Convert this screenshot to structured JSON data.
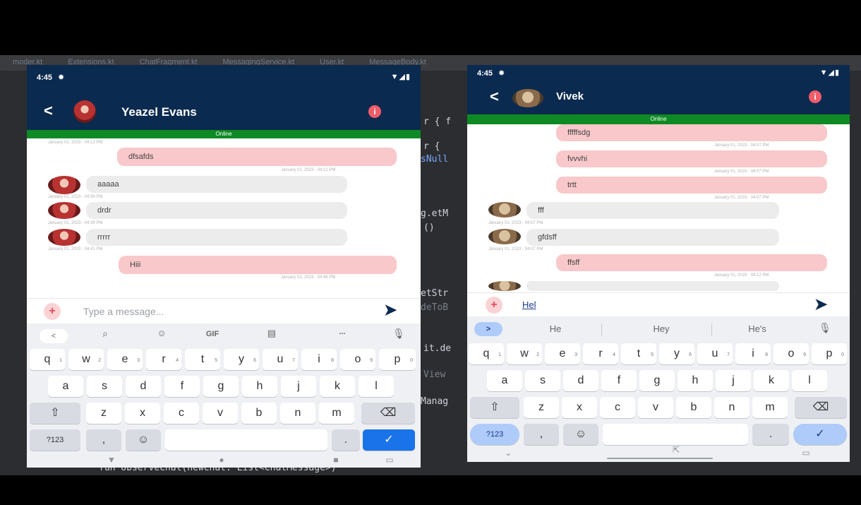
{
  "ide": {
    "tabs": [
      "moder.kt",
      "Extensions.kt",
      "ChatFragment.kt",
      "MessagingService.kt",
      "User.kt",
      "MessageBody.kt"
    ],
    "code_fragments": [
      "r { f",
      "r {",
      "sNull",
      "g.etM",
      "()",
      "etStr",
      "deToB",
      "it.de",
      "View",
      "Manag",
      "fun observeChat(newChat: List<ChatMessage>)"
    ]
  },
  "phone1": {
    "time": "4:45",
    "contact_name": "Yeazel Evans",
    "online_label": "Online",
    "messages": [
      {
        "side": "top-ts",
        "time": "January 01, 2023 - 04:12 PM"
      },
      {
        "side": "right",
        "text": "dfsafds",
        "time": "January 01, 2023 - 04:12 PM"
      },
      {
        "side": "left",
        "text": "aaaaa",
        "time": "January 01, 2023 - 04:39 PM"
      },
      {
        "side": "left",
        "text": "drdr",
        "time": "January 01, 2023 - 04:39 PM"
      },
      {
        "side": "left",
        "text": "rrrrr",
        "time": "January 01, 2023 - 04:41 PM"
      },
      {
        "side": "right",
        "text": "Hiii",
        "time": "January 01, 2023 - 04:45 PM"
      }
    ],
    "input_placeholder": "Type a message...",
    "toolbar": [
      "<",
      "search-icon",
      "sticker-icon",
      "GIF",
      "clipboard-icon",
      "...",
      "mic-icon"
    ],
    "rows": [
      [
        "q",
        "w",
        "e",
        "r",
        "t",
        "y",
        "u",
        "i",
        "o",
        "p"
      ],
      [
        "a",
        "s",
        "d",
        "f",
        "g",
        "h",
        "j",
        "k",
        "l"
      ],
      [
        "z",
        "x",
        "c",
        "v",
        "b",
        "n",
        "m"
      ]
    ],
    "superscripts": [
      "1",
      "2",
      "3",
      "4",
      "5",
      "6",
      "7",
      "8",
      "9",
      "0"
    ],
    "symbols_key": "?123",
    "comma_key": ",",
    "period_key": "."
  },
  "phone2": {
    "time": "4:45",
    "contact_name": "Vivek",
    "online_label": "Online",
    "messages": [
      {
        "side": "right",
        "text": "fffffsdg",
        "time": "January 01, 2023 - 04:07 PM"
      },
      {
        "side": "right",
        "text": "fvvvhi",
        "time": "January 01, 2023 - 04:07 PM"
      },
      {
        "side": "right",
        "text": "trtt",
        "time": "January 01, 2023 - 04:07 PM"
      },
      {
        "side": "left",
        "text": "fff",
        "time": "January 01, 2023 - 04:07 PM"
      },
      {
        "side": "left",
        "text": "gfdsff",
        "time": "January 01, 2023 - 04:07 PM"
      },
      {
        "side": "right",
        "text": "ffsff",
        "time": "January 01, 2023 - 04:12 PM"
      }
    ],
    "input_value": "Hel",
    "suggestions": [
      "He",
      "Hey",
      "He's"
    ],
    "rows": [
      [
        "q",
        "w",
        "e",
        "r",
        "t",
        "y",
        "u",
        "i",
        "o",
        "p"
      ],
      [
        "a",
        "s",
        "d",
        "f",
        "g",
        "h",
        "j",
        "k",
        "l"
      ],
      [
        "z",
        "x",
        "c",
        "v",
        "b",
        "n",
        "m"
      ]
    ],
    "superscripts": [
      "1",
      "2",
      "3",
      "4",
      "5",
      "6",
      "7",
      "8",
      "9",
      "0"
    ],
    "symbols_key": "?123",
    "comma_key": ",",
    "period_key": "."
  },
  "colors": {
    "appbar": "#0b2a4f",
    "online_bar": "#0d8a23",
    "sent_bubble": "#f8c8ca",
    "received_bubble": "#ececec",
    "accent_pink": "#f35d6a",
    "enter_key_blue": "#1a73e8"
  }
}
